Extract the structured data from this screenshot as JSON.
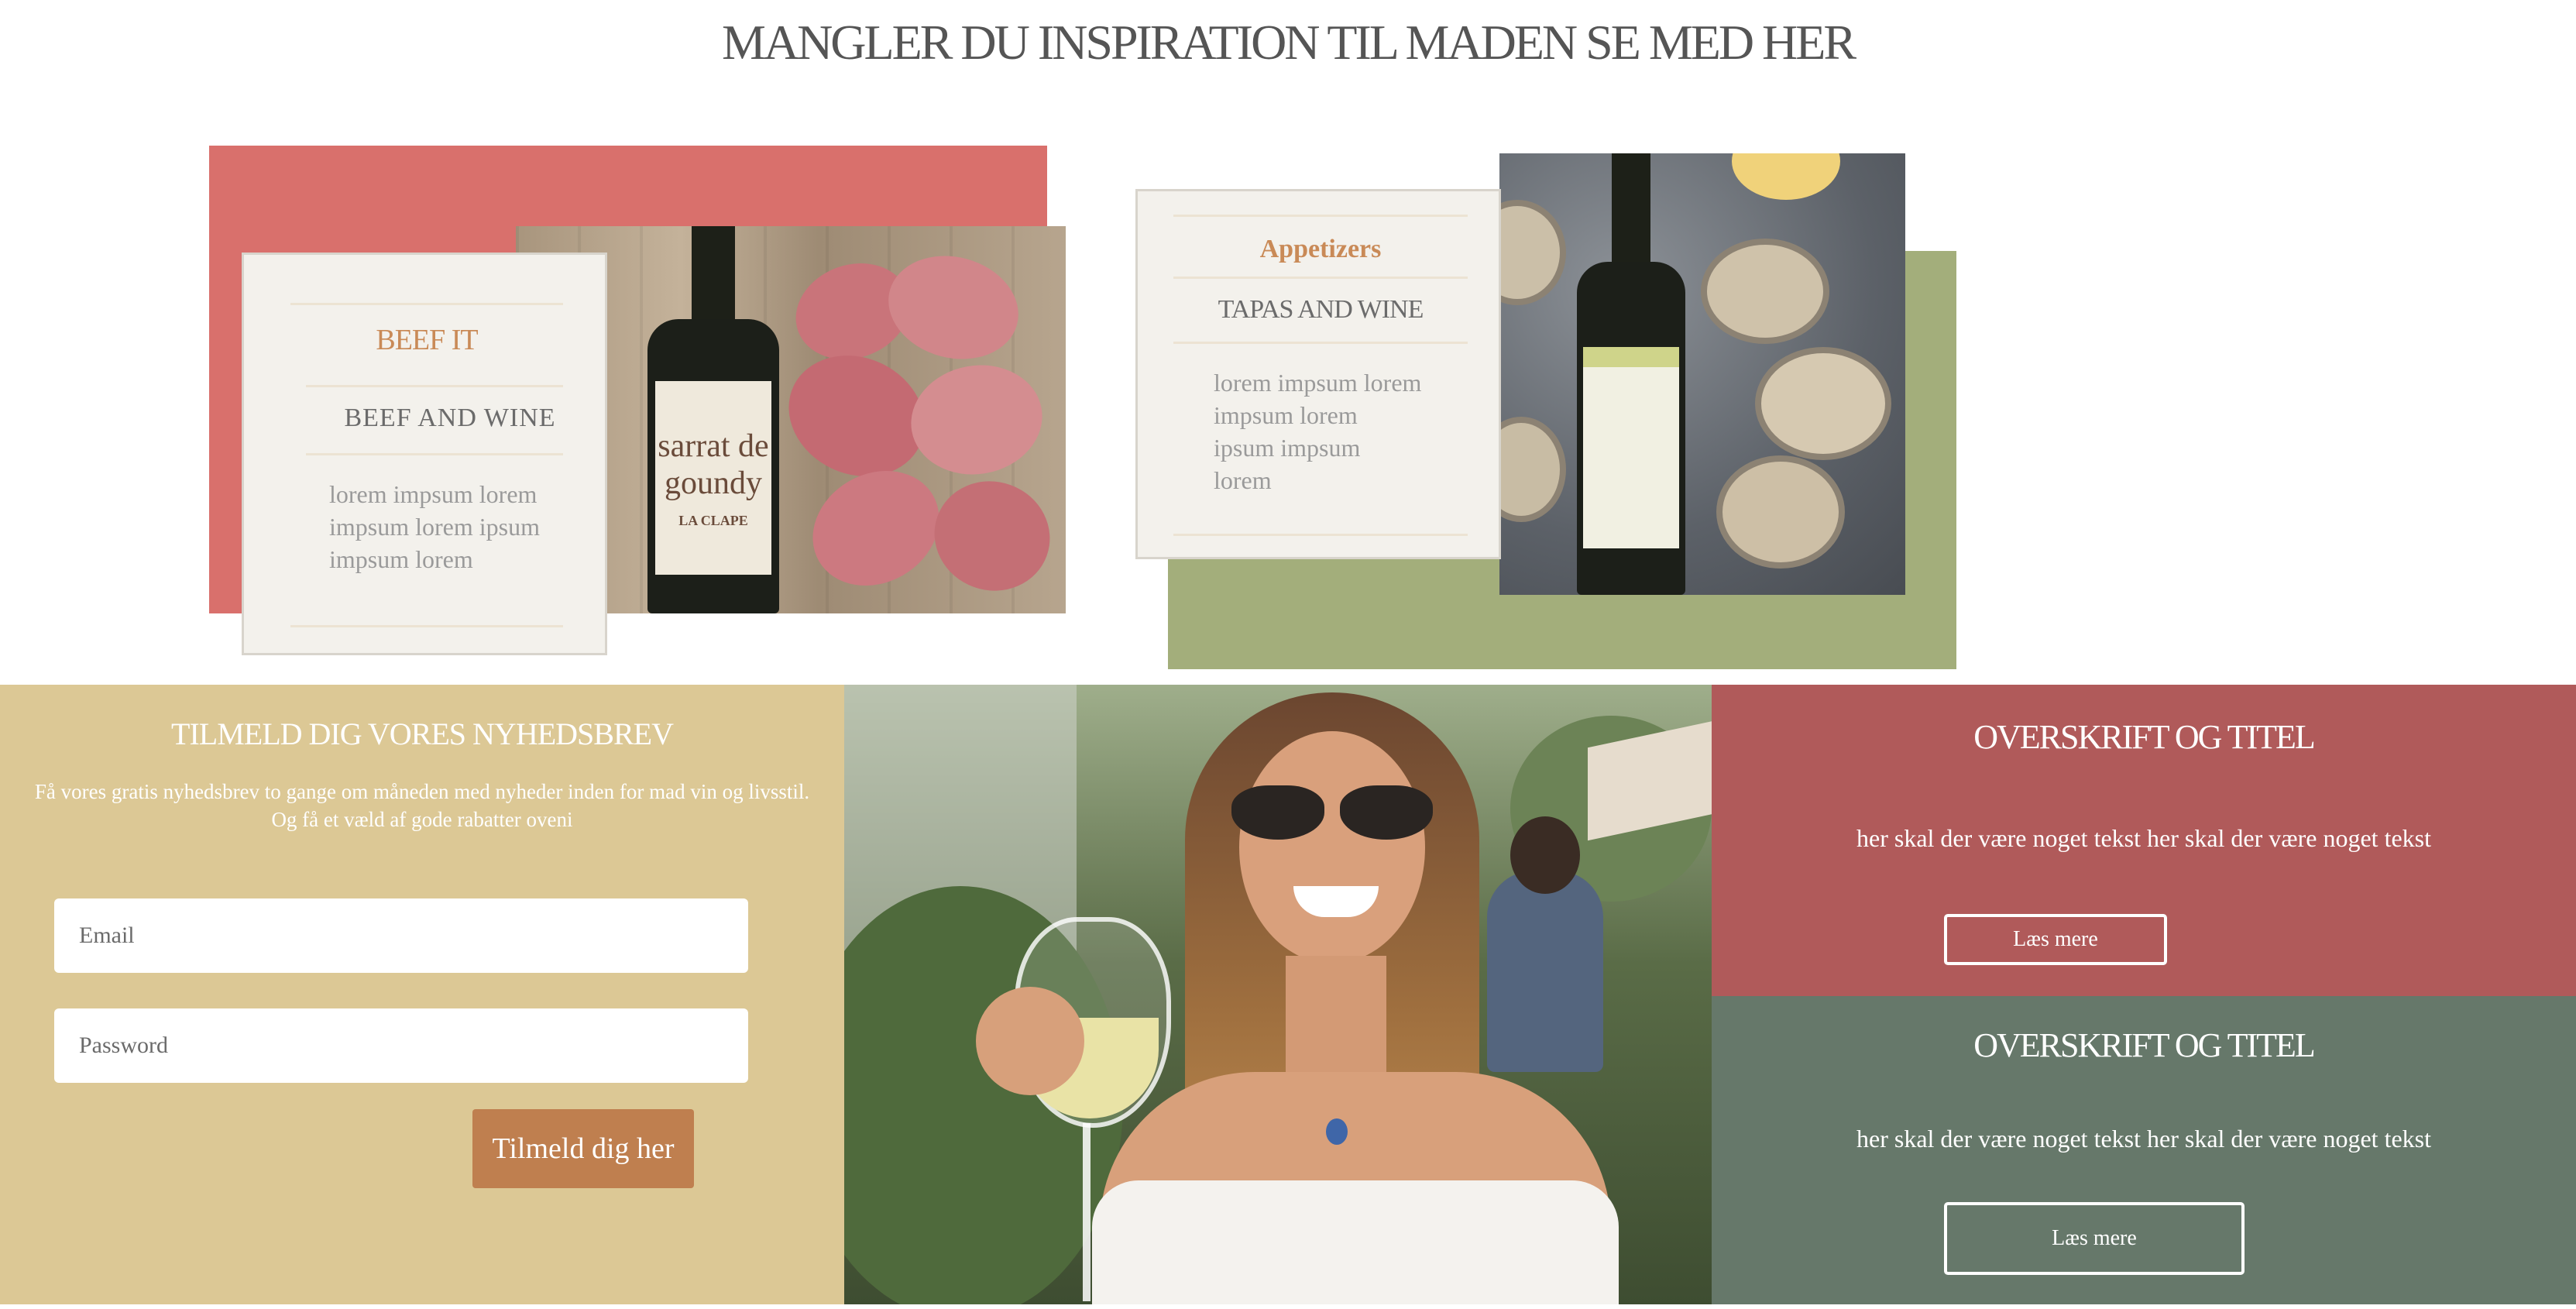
{
  "page": {
    "title": "MANGLER DU INSPIRATION TIL MADEN SE MED HER"
  },
  "cards": [
    {
      "tag": "BEEF IT",
      "heading": "BEEF AND WINE",
      "body": [
        "lorem impsum lorem",
        "impsum lorem ipsum",
        "impsum lorem"
      ],
      "accent_color": "#d9706c",
      "bottle_label": [
        "sarrat de",
        "goundy",
        "LA CLAPE"
      ]
    },
    {
      "tag": "Appetizers",
      "heading": "TAPAS AND WINE",
      "body": [
        "lorem impsum lorem",
        "impsum lorem",
        "ipsum impsum",
        "lorem"
      ],
      "accent_color": "#a3ae7b"
    }
  ],
  "newsletter": {
    "title": "TILMELD DIG VORES NYHEDSBREV",
    "text": "Få vores gratis nyhedsbrev to gange om måneden med nyheder inden for mad vin og livsstil. Og få et væld af gode rabatter oveni",
    "email_placeholder": "Email",
    "password_placeholder": "Password",
    "submit_label": "Tilmeld dig her",
    "bg_color": "#dcc895",
    "button_color": "#bf7f4f"
  },
  "promos": [
    {
      "title": "OVERSKRIFT OG TITEL",
      "text": "her skal der være noget tekst her skal der være noget tekst",
      "button_label": "Læs mere",
      "bg_color": "#b05a5a"
    },
    {
      "title": "OVERSKRIFT OG TITEL",
      "text": "her skal der være noget tekst her skal der være noget tekst",
      "button_label": "Læs mere",
      "bg_color": "#66786a"
    }
  ]
}
